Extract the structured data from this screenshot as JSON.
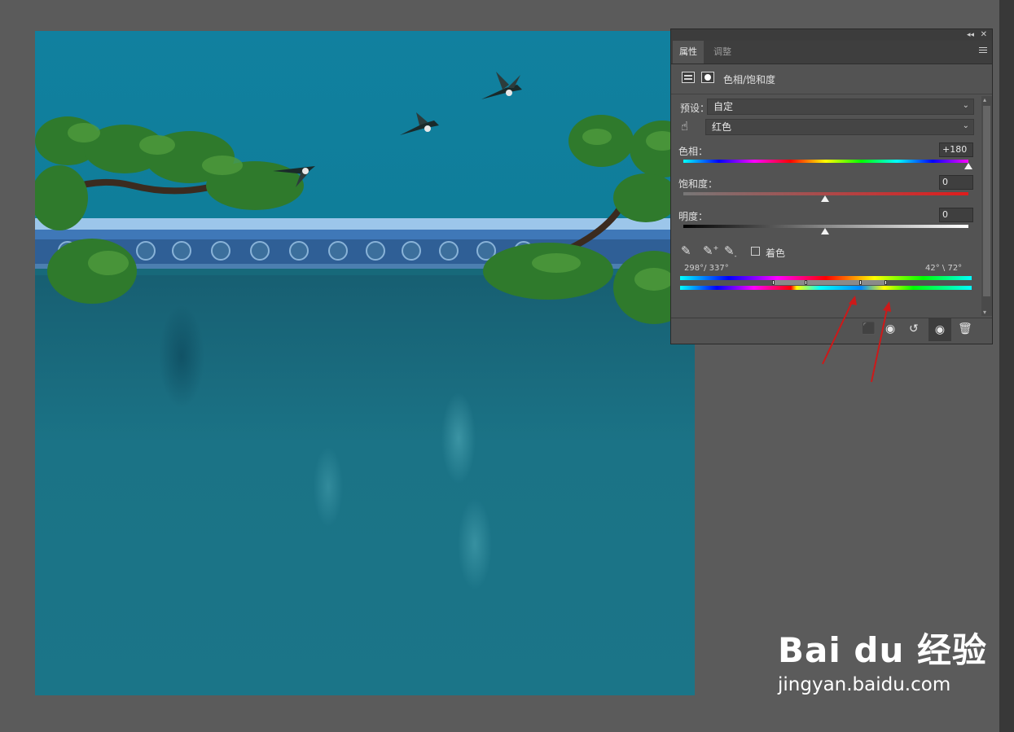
{
  "panel": {
    "tabs": [
      "属性",
      "调整"
    ],
    "active_tab": "属性",
    "header_title": "色相/饱和度",
    "preset_label": "预设：",
    "preset_value": "自定",
    "channel_value": "红色",
    "hue": {
      "label": "色相：",
      "value": "+180",
      "level": 1.0
    },
    "saturation": {
      "label": "饱和度：",
      "value": "0",
      "level": 0.5
    },
    "lightness": {
      "label": "明度：",
      "value": "0",
      "level": 0.5
    },
    "colorize_label": "着色",
    "colorize_checked": false,
    "range_left": "298°/ 337°",
    "range_right": "42° \\ 72°"
  },
  "watermark": {
    "logo": "Bai du 经验",
    "url": "jingyan.baidu.com"
  },
  "colors": {
    "canvas_sky": "#11809f",
    "wall": "#1b7386",
    "annotation_arrow": "#cc1a1a"
  },
  "icons": [
    "adjustment-layer-icon",
    "mask-icon",
    "targeted-adjustment-hand-icon",
    "eyedropper-icon",
    "eyedropper-plus-icon",
    "eyedropper-minus-icon",
    "clip-to-layer-icon",
    "view-previous-icon",
    "reset-icon",
    "visibility-eye-icon",
    "trash-icon"
  ]
}
